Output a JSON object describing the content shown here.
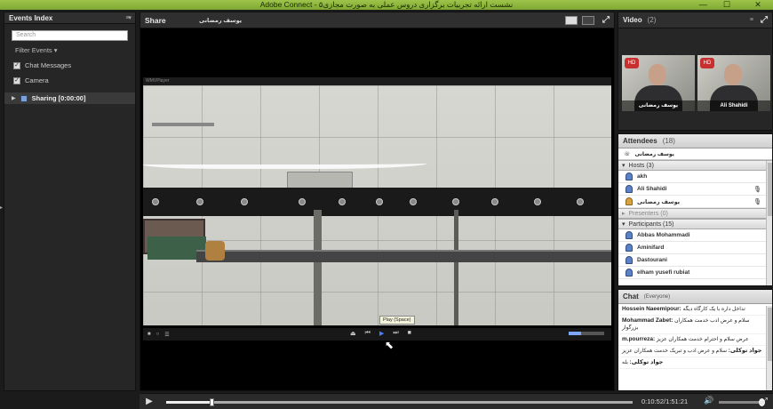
{
  "window": {
    "title": "Adobe Connect - نشست ارائه تجربیات برگزاری دروس عملی به صورت مجازی۵",
    "min": "—",
    "max": "☐",
    "close": "✕"
  },
  "events_index": {
    "title": "Events Index",
    "menu_icon": "≡▾",
    "search_placeholder": "Search",
    "filter_label": "Filter Events",
    "checkboxes": [
      {
        "label": "Chat Messages",
        "checked": true
      },
      {
        "label": "Camera",
        "checked": true
      }
    ],
    "sharing_label": "Sharing [0:00:00]"
  },
  "share": {
    "title": "Share",
    "presenter": "یوسف رمضانی",
    "player_name": "WMVPlayer",
    "tooltip": "Play (Space)"
  },
  "video_pod": {
    "title": "Video",
    "count": "(2)",
    "cameras": [
      {
        "name": "یوسف رمضانی",
        "badge": "HD"
      },
      {
        "name": "Ali Shahidi",
        "badge": "HD"
      }
    ]
  },
  "attendees": {
    "title": "Attendees",
    "count": "(18)",
    "current_user": "یوسف رمضانی",
    "groups": [
      {
        "label": "Hosts (3)",
        "members": [
          {
            "name": "akh",
            "mic": false
          },
          {
            "name": "Ali Shahidi",
            "mic": true
          },
          {
            "name": "یوسف رمضانی",
            "mic": true
          }
        ]
      },
      {
        "label": "Presenters (0)",
        "members": []
      },
      {
        "label": "Participants (15)",
        "members": [
          {
            "name": "Abbas Mohammadi",
            "mic": false
          },
          {
            "name": "Aminifard",
            "mic": false
          },
          {
            "name": "Dastourani",
            "mic": false
          },
          {
            "name": "elham yusefi rubiat",
            "mic": false
          }
        ]
      }
    ]
  },
  "chat": {
    "title": "Chat",
    "scope": "(Everyone)",
    "messages": [
      {
        "sender": "Hossein Naeemipour:",
        "text": "تداخل داره با یک کارگاه دیگه"
      },
      {
        "sender": "Mohammad Zabet:",
        "text": "سلام و عرض ادب خدمت همکاران بزرگوار"
      },
      {
        "sender": "m.pourreza:",
        "text": "عرض سلام و احترام خدمت همکاران عزیز"
      },
      {
        "sender": "جواد توکلی:",
        "text": "سلام و عرض ادب و تبریک خدمت همکاران عزیز"
      },
      {
        "sender": "جواد توکلی:",
        "text": "بله"
      }
    ]
  },
  "transport": {
    "time": "0:10:52/1:51:21",
    "progress": 0.098
  }
}
